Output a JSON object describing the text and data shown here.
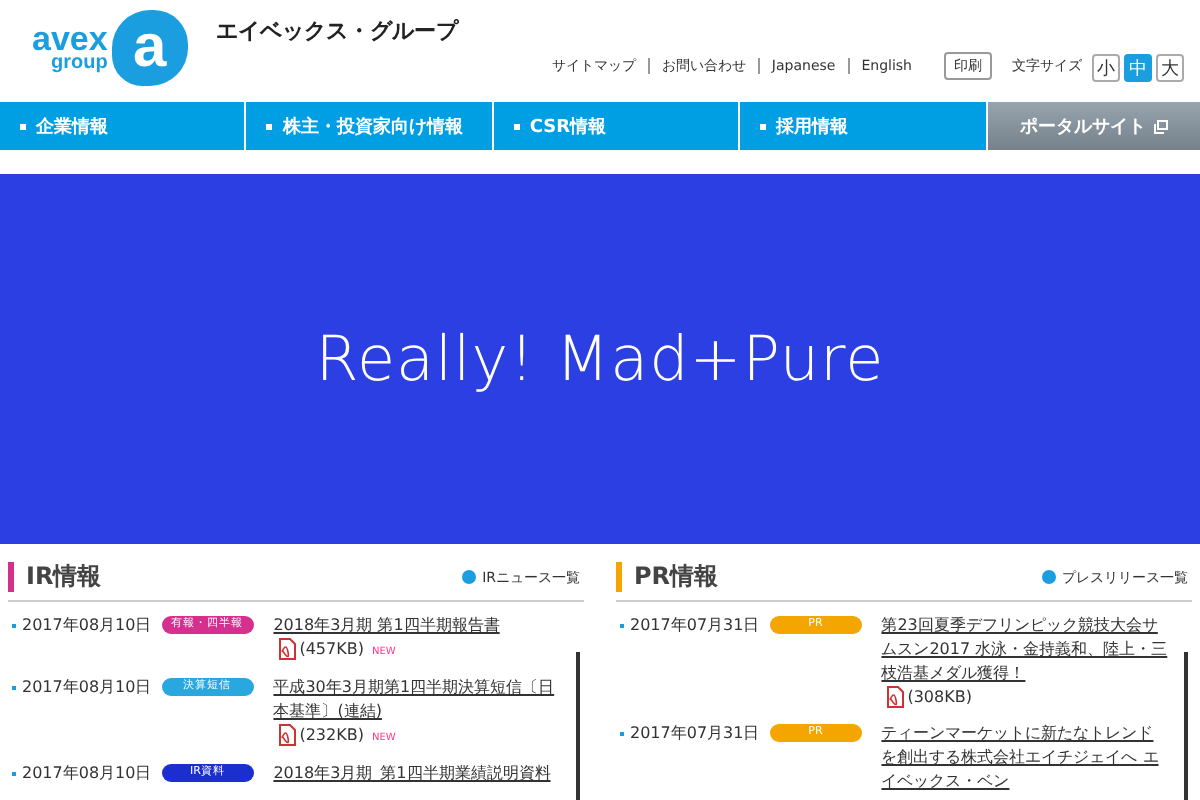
{
  "header": {
    "logo_top": "avex",
    "logo_bottom": "group",
    "logo_mark": "a",
    "company": "エイベックス・グループ",
    "links": [
      "サイトマップ",
      "お問い合わせ",
      "Japanese",
      "English"
    ],
    "print_button": "印刷",
    "font_size_label": "文字サイズ",
    "font_sizes": [
      {
        "label": "小",
        "selected": false
      },
      {
        "label": "中",
        "selected": true
      },
      {
        "label": "大",
        "selected": false
      }
    ]
  },
  "nav": [
    {
      "label": "企業情報",
      "kind": "main"
    },
    {
      "label": "株主・投資家向け情報",
      "kind": "main"
    },
    {
      "label": "CSR情報",
      "kind": "main"
    },
    {
      "label": "採用情報",
      "kind": "main"
    },
    {
      "label": "ポータルサイト",
      "kind": "portal"
    }
  ],
  "banner": {
    "text": "Really! Mad+Pure"
  },
  "sections": [
    {
      "title": "IR情報",
      "color": "#d6308f",
      "more": "IRニュース一覧",
      "items": [
        {
          "date": "2017年08月10日",
          "tag": "有報・四半報",
          "color": "#d6308f",
          "title": "2018年3月期 第1四半期報告書",
          "pdf": true,
          "size": "(457KB)",
          "new": "NEW"
        },
        {
          "date": "2017年08月10日",
          "tag": "決算短信",
          "color": "#29a8e0",
          "title": "平成30年3月期第1四半期決算短信〔日本基準〕(連結)",
          "pdf": true,
          "size": "(232KB)",
          "new": "NEW"
        },
        {
          "date": "2017年08月10日",
          "tag": "IR資料",
          "color": "#1b2fd0",
          "title": "2018年3月期_第1四半期業績説明資料",
          "pdf": false
        }
      ]
    },
    {
      "title": "PR情報",
      "color": "#f5a500",
      "more": "プレスリリース一覧",
      "items": [
        {
          "date": "2017年07月31日",
          "tag": "PR",
          "color": "#f5a500",
          "title": "第23回夏季デフリンピック競技大会サムスン2017 水泳・金持義和、陸上・三枝浩基メダル獲得！",
          "pdf": true,
          "size": "(308KB)"
        },
        {
          "date": "2017年07月31日",
          "tag": "PR",
          "color": "#f5a500",
          "title": "ティーンマーケットに新たなトレンドを創出する株式会社エイチジェイへ エイベックス・ベン",
          "pdf": false
        }
      ]
    }
  ]
}
